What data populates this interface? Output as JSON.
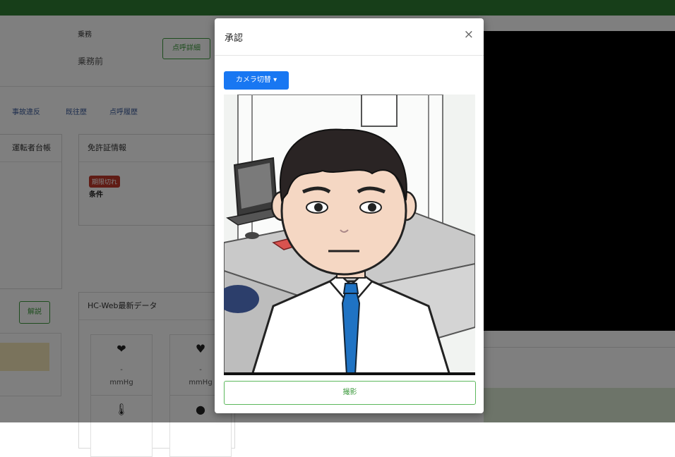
{
  "background": {
    "duty": {
      "label": "乗務",
      "value": "乗務前",
      "detail_button": "点呼詳細"
    },
    "tabs": [
      "事故違反",
      "既往歴",
      "点呼履歴"
    ],
    "driver_ledger": {
      "title": "運転者台帳"
    },
    "license": {
      "title": "免許証情報",
      "badge": "期限切れ",
      "condition_label": "条件"
    },
    "explain_button": "解説",
    "hcweb": {
      "title": "HC-Web最新データ",
      "vitals": [
        {
          "icon": "heart-pulse-icon",
          "value": "-",
          "unit": "mmHg"
        },
        {
          "icon": "heart-rate-icon",
          "value": "-",
          "unit": "mmHg"
        }
      ]
    }
  },
  "modal": {
    "title": "承認",
    "close_label": "×",
    "camera_switch_label": "カメラ切替 ▾",
    "capture_label": "撮影"
  },
  "colors": {
    "topbar": "#2e7d32",
    "primary": "#1877f2",
    "success": "#5cb85c",
    "danger": "#c0392b"
  }
}
